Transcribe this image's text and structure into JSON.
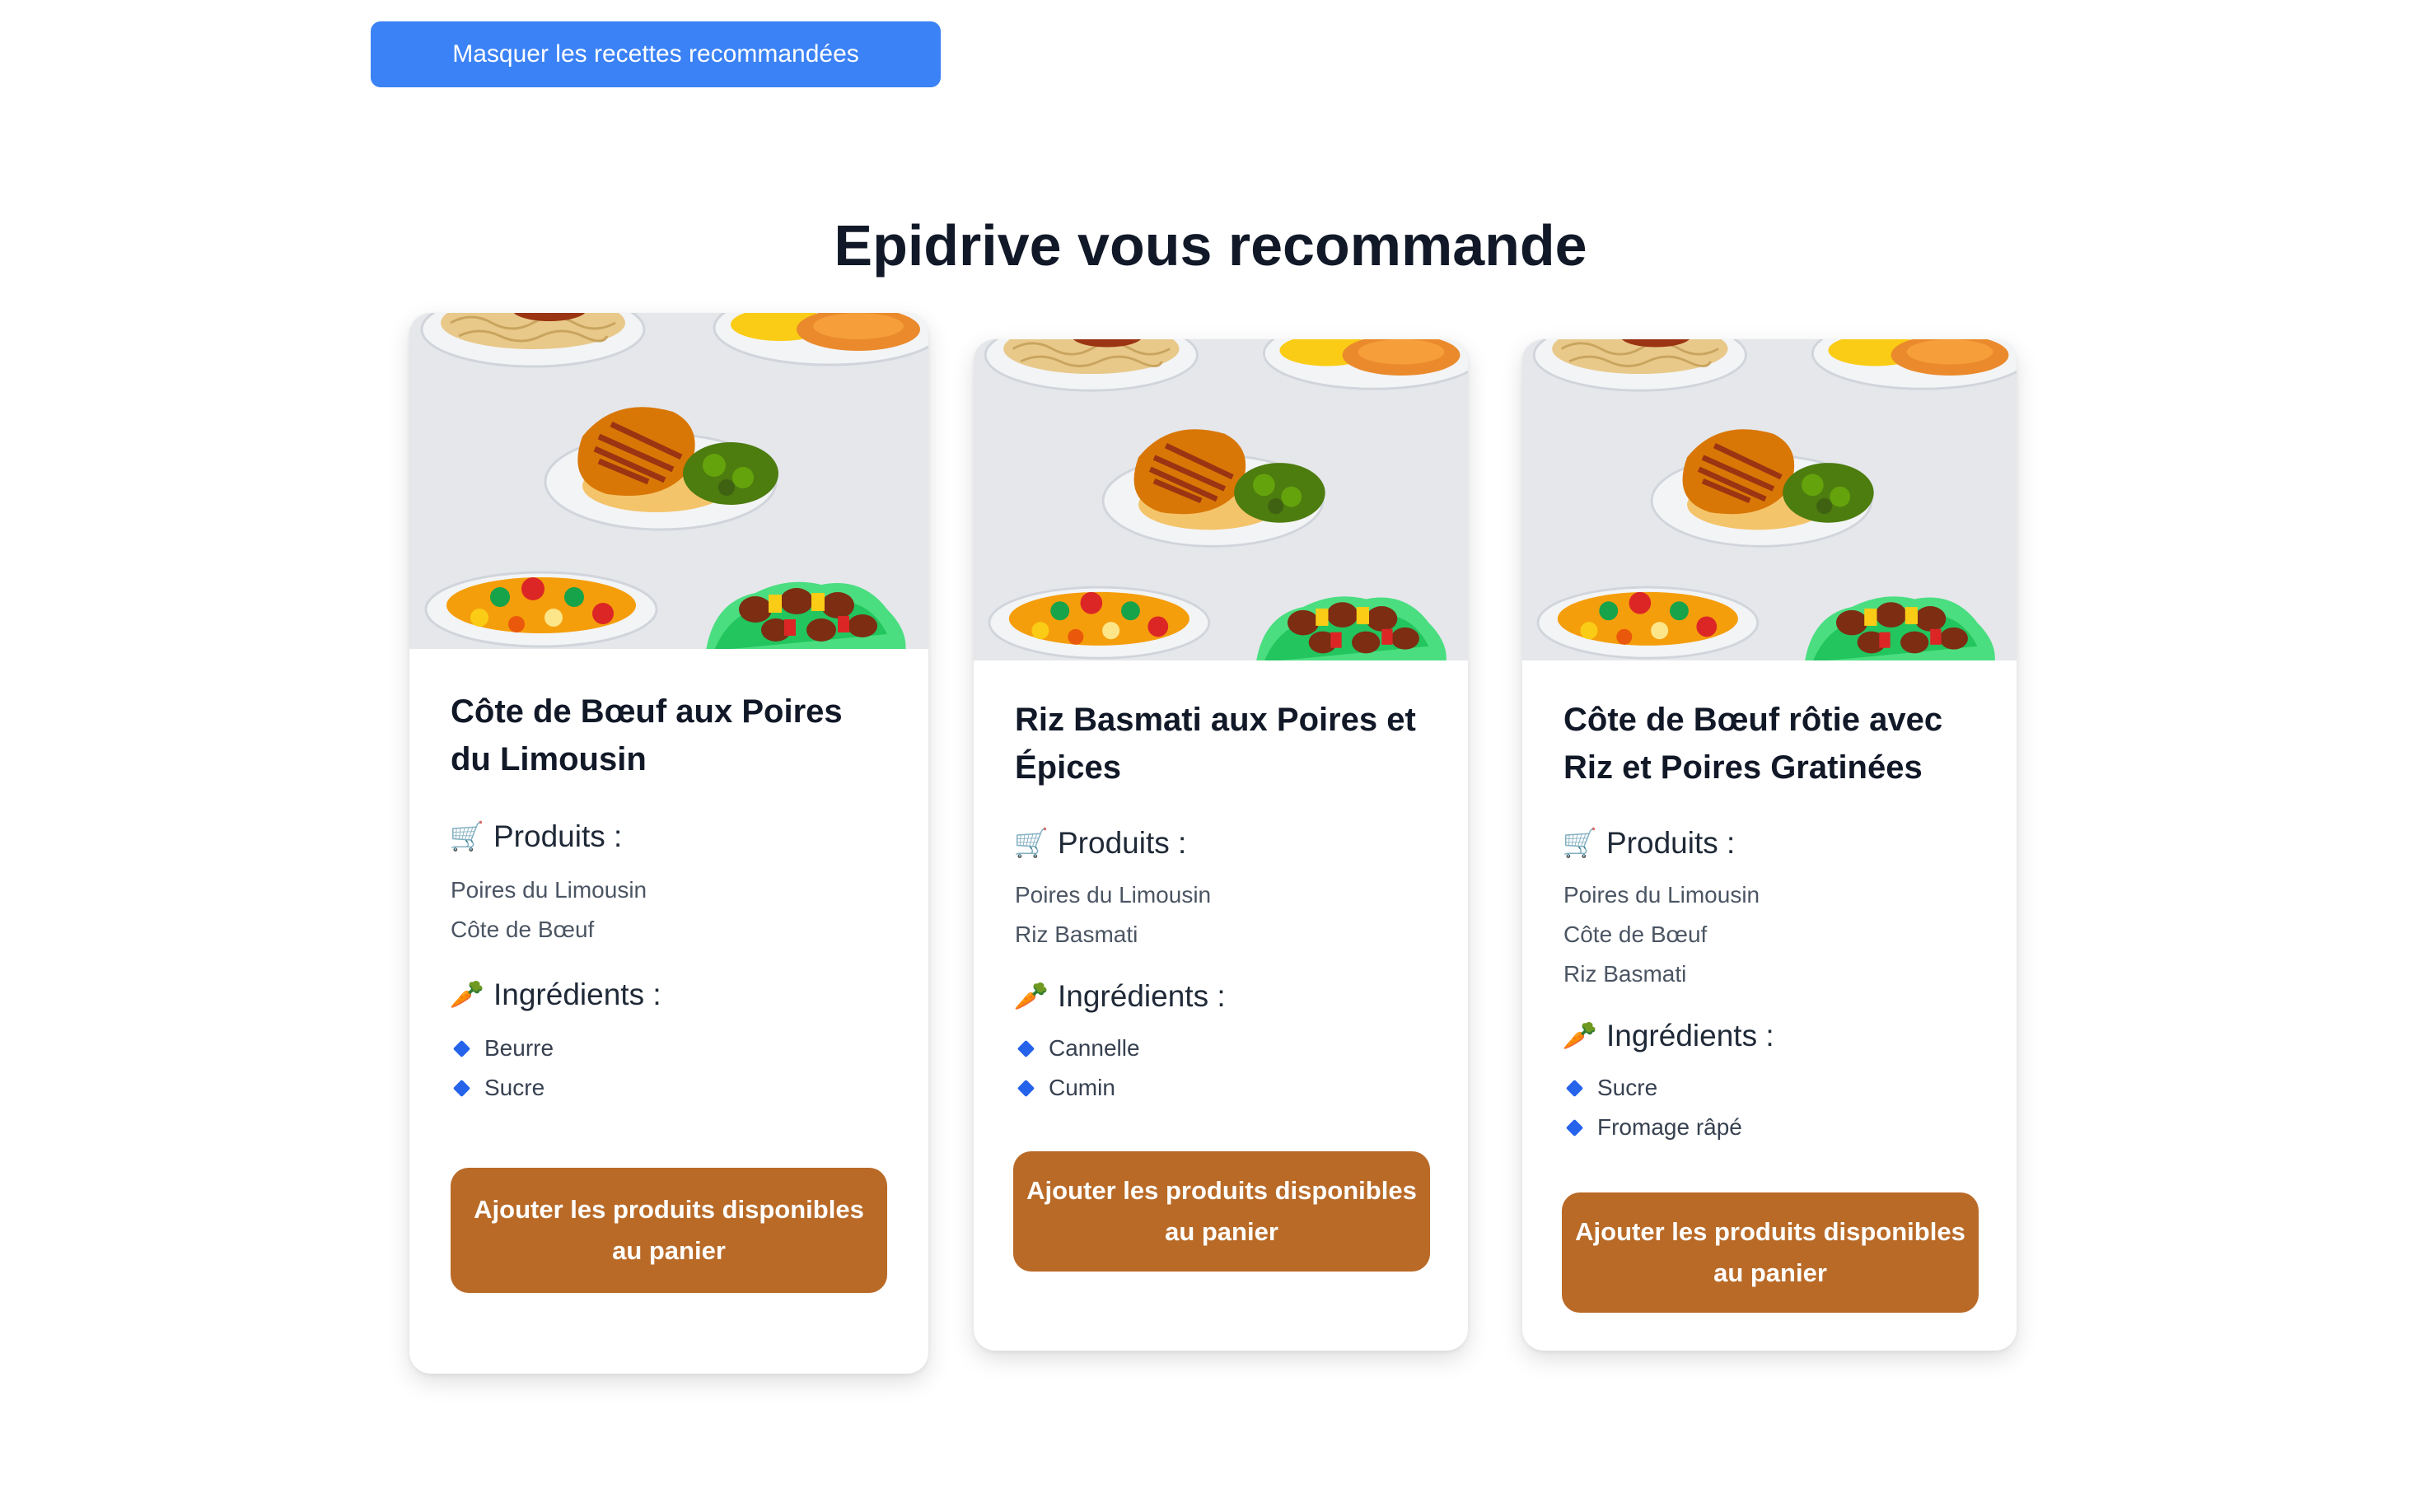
{
  "toggle_label": "Masquer les recettes recommandées",
  "section_title": "Epidrive vous recommande",
  "recipes": [
    {
      "title": "Côte de Bœuf aux Poires du Limousin",
      "products_heading": "Produits :",
      "products": [
        "Poires du Limousin",
        "Côte de Bœuf"
      ],
      "ingredients_heading": "Ingrédients :",
      "ingredients": [
        "Beurre",
        "Sucre"
      ],
      "button_label": "Ajouter les produits disponibles au panier"
    },
    {
      "title": "Riz Basmati aux Poires et Épices",
      "products_heading": "Produits :",
      "products": [
        "Poires du Limousin",
        "Riz Basmati"
      ],
      "ingredients_heading": "Ingrédients :",
      "ingredients": [
        "Cannelle",
        "Cumin"
      ],
      "button_label": "Ajouter les produits disponibles au panier"
    },
    {
      "title": "Côte de Bœuf rôtie avec Riz et Poires Gratinées",
      "products_heading": "Produits :",
      "products": [
        "Poires du Limousin",
        "Côte de Bœuf",
        "Riz Basmati"
      ],
      "ingredients_heading": "Ingrédients :",
      "ingredients": [
        "Sucre",
        "Fromage râpé"
      ],
      "button_label": "Ajouter les produits disponibles au panier"
    }
  ],
  "icons": {
    "products": "shopping-cart-icon",
    "ingredients": "carrot-icon",
    "bullet": "blue-diamond-icon"
  },
  "colors": {
    "toggle_button": "#3b82f6",
    "add_button": "#b96a27",
    "image_background": "#e5e7eb",
    "bullet": "#2563eb"
  }
}
